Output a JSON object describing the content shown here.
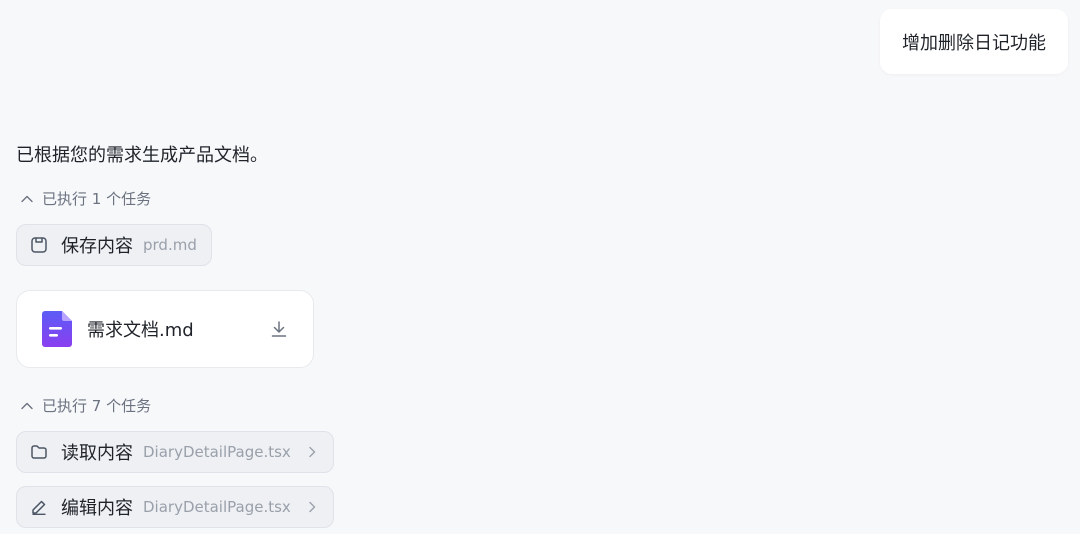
{
  "user_message": {
    "text": "增加删除日记功能"
  },
  "assistant": {
    "reply": "已根据您的需求生成产品文档。",
    "task_group_1": {
      "toggle_label": "已执行 1 个任务",
      "chip": {
        "label": "保存内容",
        "file": "prd.md",
        "icon": "save-icon"
      }
    },
    "file_card": {
      "name": "需求文档.md",
      "icon": "document-icon",
      "action_icon": "download-icon",
      "accent": "#7b4df6"
    },
    "task_group_2": {
      "toggle_label": "已执行 7 个任务",
      "chips": [
        {
          "label": "读取内容",
          "file": "DiaryDetailPage.tsx",
          "icon": "folder-icon"
        },
        {
          "label": "编辑内容",
          "file": "DiaryDetailPage.tsx",
          "icon": "pencil-icon"
        }
      ]
    }
  }
}
